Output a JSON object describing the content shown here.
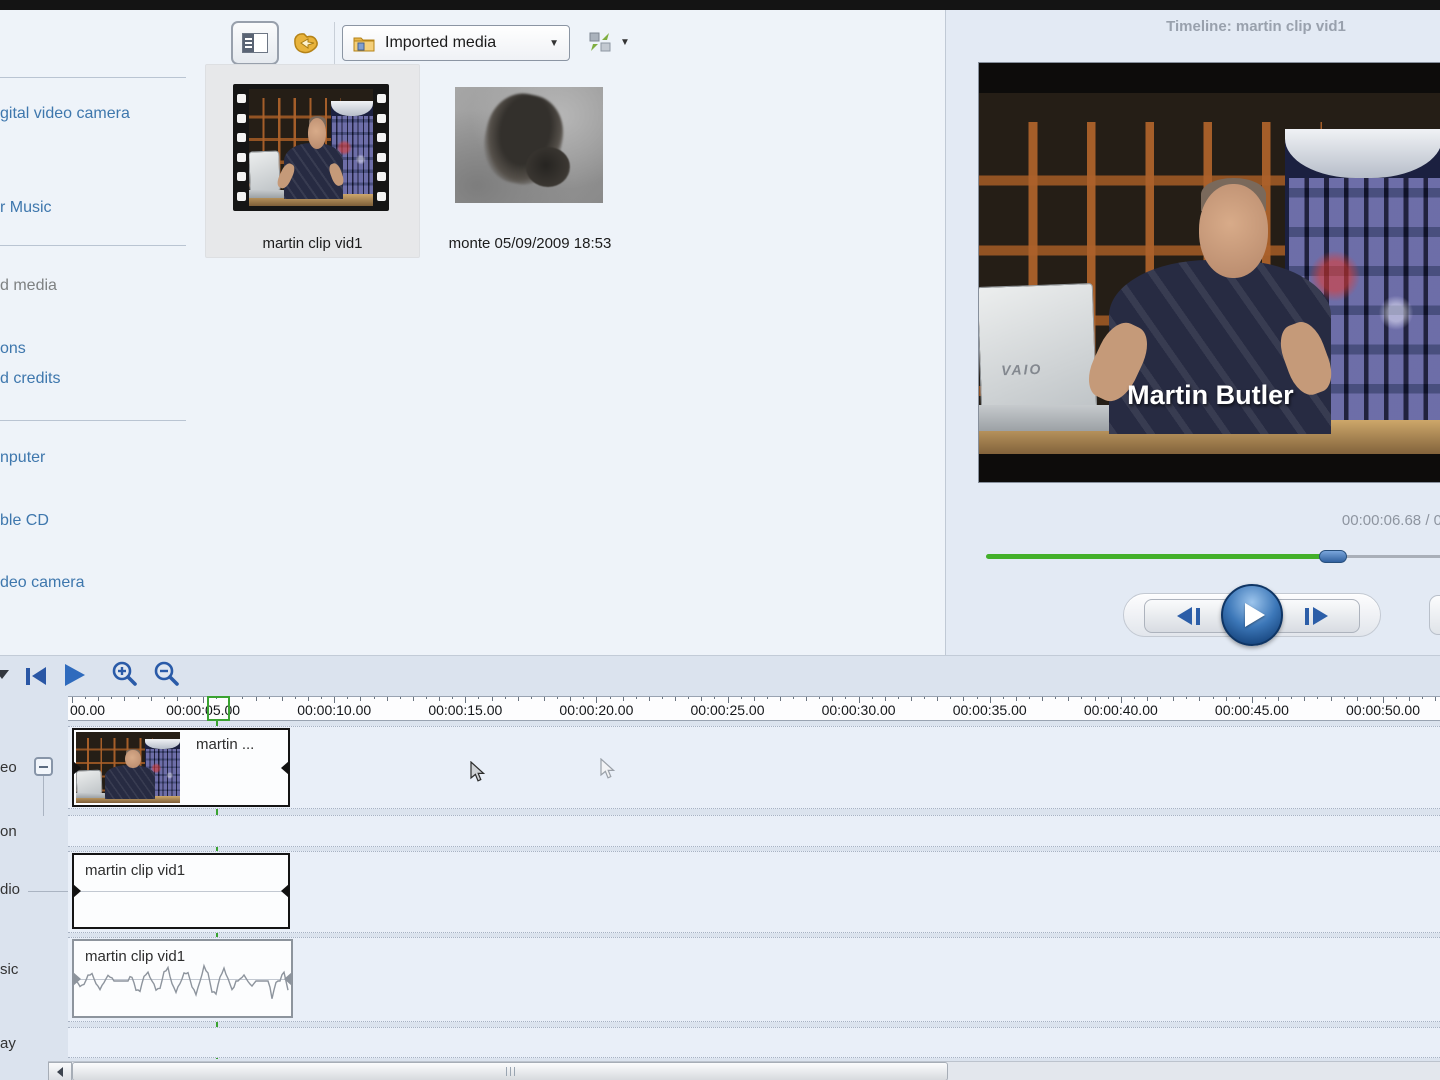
{
  "toolbar": {
    "collection_dropdown_value": "Imported media"
  },
  "icons": {
    "dropdown_arrow": "▼"
  },
  "sidebar": {
    "items": [
      {
        "label": "gital video camera",
        "active": false
      },
      {
        "label": "r Music",
        "active": false
      },
      {
        "label": "d media",
        "active": true
      },
      {
        "label": "ons",
        "active": false
      },
      {
        "label": "d credits",
        "active": false
      },
      {
        "label": "nputer",
        "active": false
      },
      {
        "label": "ble CD",
        "active": false
      },
      {
        "label": "deo camera",
        "active": false
      }
    ]
  },
  "media_library": {
    "items": [
      {
        "caption": "martin clip vid1",
        "kind": "video",
        "selected": true
      },
      {
        "caption": "monte 05/09/2009 18:53",
        "kind": "photo",
        "selected": false
      }
    ]
  },
  "preview": {
    "title": "Timeline: martin clip vid1",
    "video_overlay_text": "Martin Butler",
    "laptop_brand_text": "VAIO",
    "time_display": "00:00:06.68 / 0",
    "progress_percent": 76
  },
  "timeline": {
    "ruler_labels": [
      "00.00",
      "00:00:05.00",
      "00:00:10.00",
      "00:00:15.00",
      "00:00:20.00",
      "00:00:25.00",
      "00:00:30.00",
      "00:00:35.00",
      "00:00:40.00",
      "00:00:45.00",
      "00:00:50.00"
    ],
    "seconds_per_major": 5,
    "tracks": [
      {
        "label": "eo"
      },
      {
        "label": "on"
      },
      {
        "label": "dio"
      },
      {
        "label": "sic"
      },
      {
        "label": "ay"
      }
    ],
    "clips": {
      "video_label": "martin ...",
      "audio_label": "martin clip vid1",
      "music_label": "martin clip vid1"
    }
  },
  "colors": {
    "playhead_green": "#3aa331",
    "progress_green": "#43b02a",
    "link_blue": "#3e77ad"
  }
}
